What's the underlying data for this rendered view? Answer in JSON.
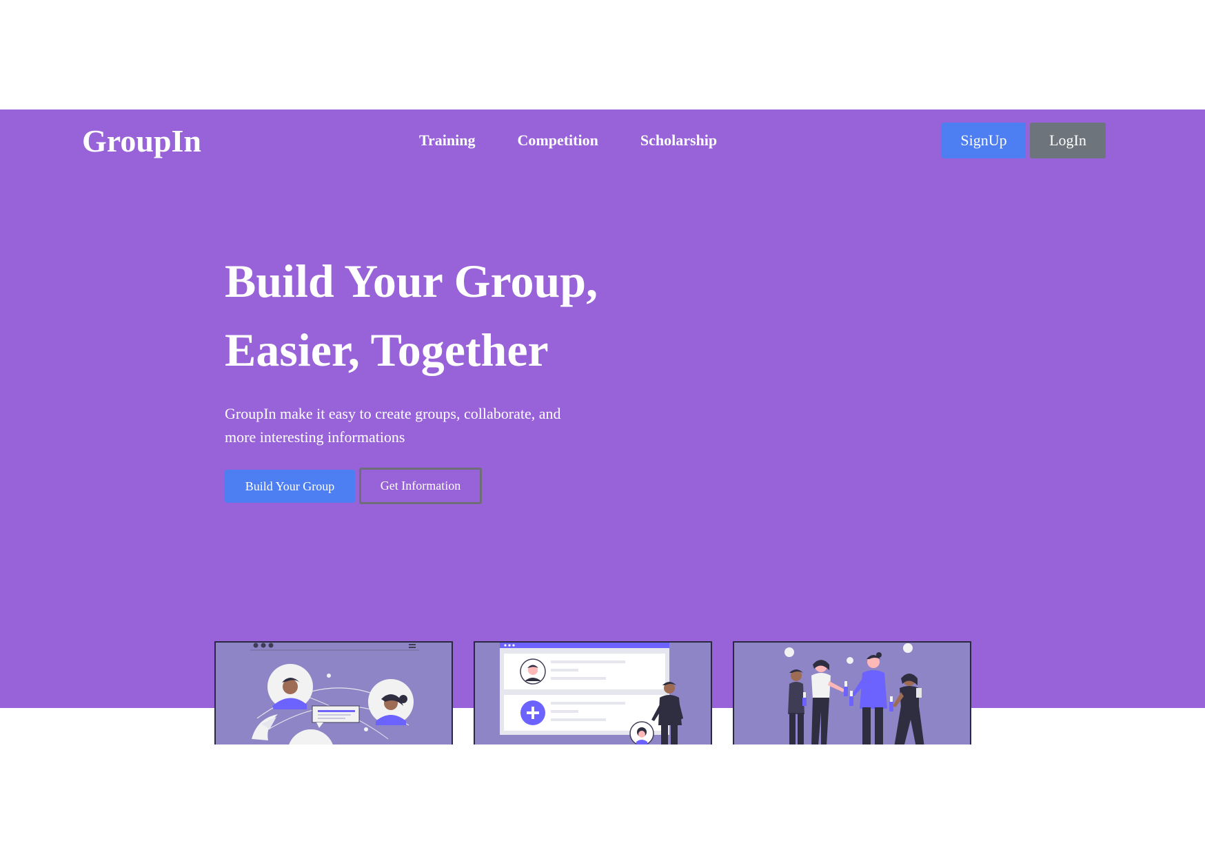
{
  "brand": {
    "logo_text": "GroupIn"
  },
  "nav": {
    "items": [
      {
        "label": "Training"
      },
      {
        "label": "Competition"
      },
      {
        "label": "Scholarship"
      }
    ]
  },
  "auth": {
    "signup_label": "SignUp",
    "login_label": "LogIn"
  },
  "hero": {
    "headline_line1": "Build Your Group,",
    "headline_line2": "Easier, Together",
    "subtext": "GroupIn make it easy to create groups, collaborate, and more interesting informations",
    "primary_cta": "Build Your Group",
    "secondary_cta": "Get Information"
  },
  "illustrations": [
    {
      "icon": "chat-people-illustration"
    },
    {
      "icon": "profile-list-illustration"
    },
    {
      "icon": "people-toasting-illustration"
    }
  ],
  "colors": {
    "hero_background": "#9862d8",
    "primary_button": "#4d7ef2",
    "secondary_button": "#6d747b",
    "card_background": "#8e85c6",
    "accent": "#6c63ff"
  }
}
